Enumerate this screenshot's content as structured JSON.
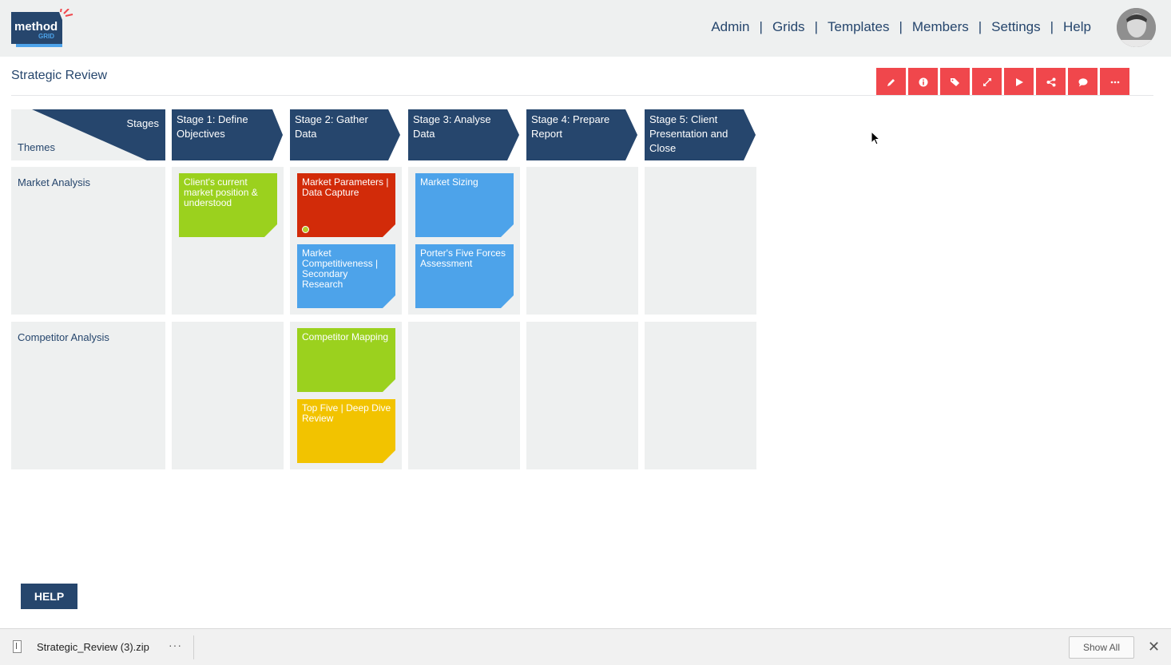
{
  "header": {
    "logo_text": "method",
    "logo_subtext": "GRID",
    "nav": [
      "Admin",
      "Grids",
      "Templates",
      "Members",
      "Settings",
      "Help"
    ],
    "nav_separator": "|"
  },
  "page": {
    "title": "Strategic Review"
  },
  "toolbar": {
    "color": "#f0474c",
    "icons": [
      "pencil-icon",
      "info-icon",
      "tags-icon",
      "expand-icon",
      "play-icon",
      "share-icon",
      "comment-icon",
      "more-icon"
    ]
  },
  "grid": {
    "corner": {
      "stages_label": "Stages",
      "themes_label": "Themes"
    },
    "stages": [
      "Stage 1: Define Objectives",
      "Stage 2: Gather Data",
      "Stage 3: Analyse Data",
      "Stage 4: Prepare Report",
      "Stage 5: Client Presentation and Close"
    ],
    "themes": [
      {
        "name": "Market Analysis",
        "cards": [
          {
            "stage": 1,
            "slot": 0,
            "label": "Client's current market position & understood",
            "color": "#9bd11e"
          },
          {
            "stage": 2,
            "slot": 0,
            "label": "Market Parameters | Data Capture",
            "color": "#d22b09",
            "indicator": true
          },
          {
            "stage": 2,
            "slot": 1,
            "label": "Market Competitiveness | Secondary Research",
            "color": "#4da3ea"
          },
          {
            "stage": 3,
            "slot": 0,
            "label": "Market Sizing",
            "color": "#4da3ea"
          },
          {
            "stage": 3,
            "slot": 1,
            "label": "Porter's Five Forces Assessment",
            "color": "#4da3ea"
          }
        ]
      },
      {
        "name": "Competitor Analysis",
        "cards": [
          {
            "stage": 2,
            "slot": 0,
            "label": "Competitor Mapping",
            "color": "#9bd11e"
          },
          {
            "stage": 2,
            "slot": 1,
            "label": "Top Five | Deep Dive Review",
            "color": "#f2c300"
          }
        ]
      }
    ],
    "header_color": "#26466d"
  },
  "help_button": {
    "label": "HELP"
  },
  "download_bar": {
    "file_name": "Strategic_Review (3).zip",
    "more_label": "···",
    "show_all_label": "Show All",
    "close_label": "✕"
  }
}
